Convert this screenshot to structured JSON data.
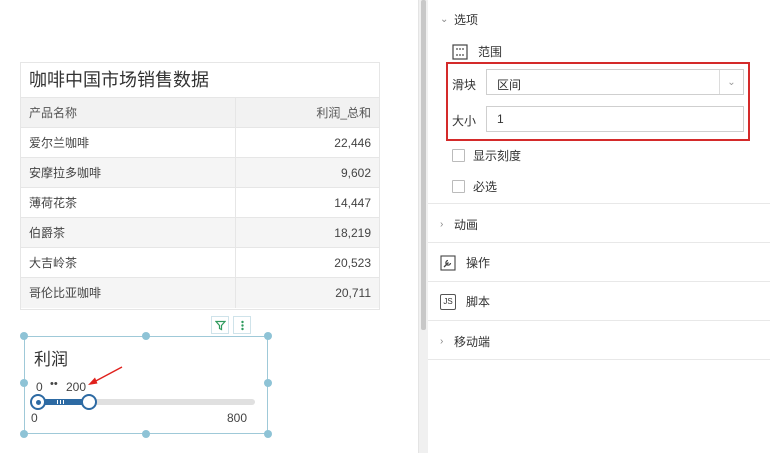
{
  "table": {
    "title": "咖啡中国市场销售数据",
    "headers": [
      "产品名称",
      "利润_总和"
    ],
    "rows": [
      [
        "爱尔兰咖啡",
        "22,446"
      ],
      [
        "安摩拉多咖啡",
        "9,602"
      ],
      [
        "薄荷花茶",
        "14,447"
      ],
      [
        "伯爵茶",
        "18,219"
      ],
      [
        "大吉岭茶",
        "20,523"
      ],
      [
        "哥伦比亚咖啡",
        "20,711"
      ]
    ]
  },
  "slider": {
    "title": "利润",
    "selected_min": "0",
    "dots": "••",
    "selected_max": "200",
    "range_min": "0",
    "range_max": "800",
    "selected_fraction": 0.25
  },
  "panel": {
    "options_label": "选项",
    "range_label": "范围",
    "slider_field_label": "滑块",
    "slider_mode_value": "区间",
    "size_label": "大小",
    "size_value": "1",
    "show_ticks_label": "显示刻度",
    "required_label": "必选",
    "animation_label": "动画",
    "action_label": "操作",
    "script_label": "脚本",
    "script_icon_text": "JS",
    "mobile_label": "移动端"
  },
  "colors": {
    "highlight": "#d42a2a",
    "slider_accent": "#2d6aa3",
    "selection_handle": "#8ec3d6",
    "toolbar_icon": "#2e9a5d"
  },
  "icons": [
    "filter-icon",
    "more-vertical-icon",
    "range-icon",
    "wrench-icon",
    "script-icon",
    "chevron-down-icon",
    "chevron-right-icon"
  ]
}
